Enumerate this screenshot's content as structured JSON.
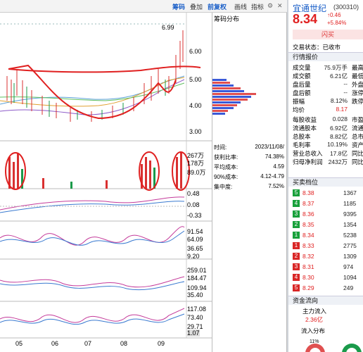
{
  "toolbar": {
    "items": [
      "筹码",
      "叠加",
      "前复权",
      "画线",
      "指标"
    ]
  },
  "chart": {
    "price_annotation": "6.99",
    "price_axis": [
      "6.00",
      "5.00",
      "4.00",
      "3.00"
    ],
    "vol_axis": [
      "267万",
      "178万",
      "89.0万"
    ],
    "macd_axis": [
      "0.48",
      "0.08",
      "-0.33"
    ],
    "kdj_axis": [
      "91.54",
      "64.09",
      "36.65",
      "9.20"
    ],
    "cci_axis": [
      "259.01",
      "184.47",
      "109.94",
      "35.40"
    ],
    "rsi_axis": [
      "117.08",
      "73.40",
      "29.71",
      "1.07"
    ],
    "months": [
      "05",
      "06",
      "07",
      "08",
      "09"
    ]
  },
  "chips": {
    "title": "筹码分布",
    "rows": [
      {
        "label": "时间:",
        "value": "2023/11/08/"
      },
      {
        "label": "获利比率:",
        "value": "74.38%"
      },
      {
        "label": "平均成本:",
        "value": "4.59"
      },
      {
        "label": "90%成本:",
        "value": "4.12-4.79"
      },
      {
        "label": "集中度:",
        "value": "7.52%"
      }
    ]
  },
  "quote": {
    "name": "宜通世纪",
    "code": "(300310)",
    "price": "8.34",
    "change": "↑0.46",
    "pct": "+5.84%",
    "fav": "闪买",
    "status": "交易状态：已收市",
    "section_quote": "行情报价",
    "rows": [
      {
        "label": "成交量",
        "value": "75.9万手",
        "label2": "最高",
        "color": "black"
      },
      {
        "label": "成交额",
        "value": "6.21亿",
        "label2": "最低",
        "color": "black"
      },
      {
        "label": "盘后量",
        "value": "--",
        "label2": "外盘",
        "color": "black"
      },
      {
        "label": "盘后额",
        "value": "--",
        "label2": "涨停",
        "color": "black"
      },
      {
        "label": "振幅",
        "value": "8.12%",
        "label2": "跌停",
        "color": "black"
      },
      {
        "label": "均价",
        "value": "8.17",
        "label2": "",
        "color": "red"
      }
    ],
    "fund_rows": [
      {
        "label": "每股收益",
        "value": "0.028",
        "label2": "市盈率"
      },
      {
        "label": "流通股本",
        "value": "6.92亿",
        "label2": "流通市"
      },
      {
        "label": "总股本",
        "value": "8.82亿",
        "label2": "总市值"
      },
      {
        "label": "毛利率",
        "value": "10.19%",
        "label2": "资产净"
      },
      {
        "label": "营业总收入",
        "value": "17.8亿",
        "label2": "同比"
      },
      {
        "label": "归母净利润",
        "value": "2432万",
        "label2": "同比"
      }
    ],
    "section_book": "买卖档位",
    "asks": [
      {
        "lvl": "5",
        "price": "8.38",
        "vol": "1367"
      },
      {
        "lvl": "4",
        "price": "8.37",
        "vol": "1185"
      },
      {
        "lvl": "3",
        "price": "8.36",
        "vol": "9395"
      },
      {
        "lvl": "2",
        "price": "8.35",
        "vol": "1354"
      },
      {
        "lvl": "1",
        "price": "8.34",
        "vol": "5238"
      }
    ],
    "bids": [
      {
        "lvl": "1",
        "price": "8.33",
        "vol": "2775"
      },
      {
        "lvl": "2",
        "price": "8.32",
        "vol": "1309"
      },
      {
        "lvl": "3",
        "price": "8.31",
        "vol": "974"
      },
      {
        "lvl": "4",
        "price": "8.30",
        "vol": "1094"
      },
      {
        "lvl": "5",
        "price": "8.29",
        "vol": "249"
      }
    ],
    "section_flow": "资金流向",
    "flow_label": "主力流入",
    "flow_value": "2.36亿",
    "flow_dist": "流入分布",
    "pie_pct": "11%"
  }
}
